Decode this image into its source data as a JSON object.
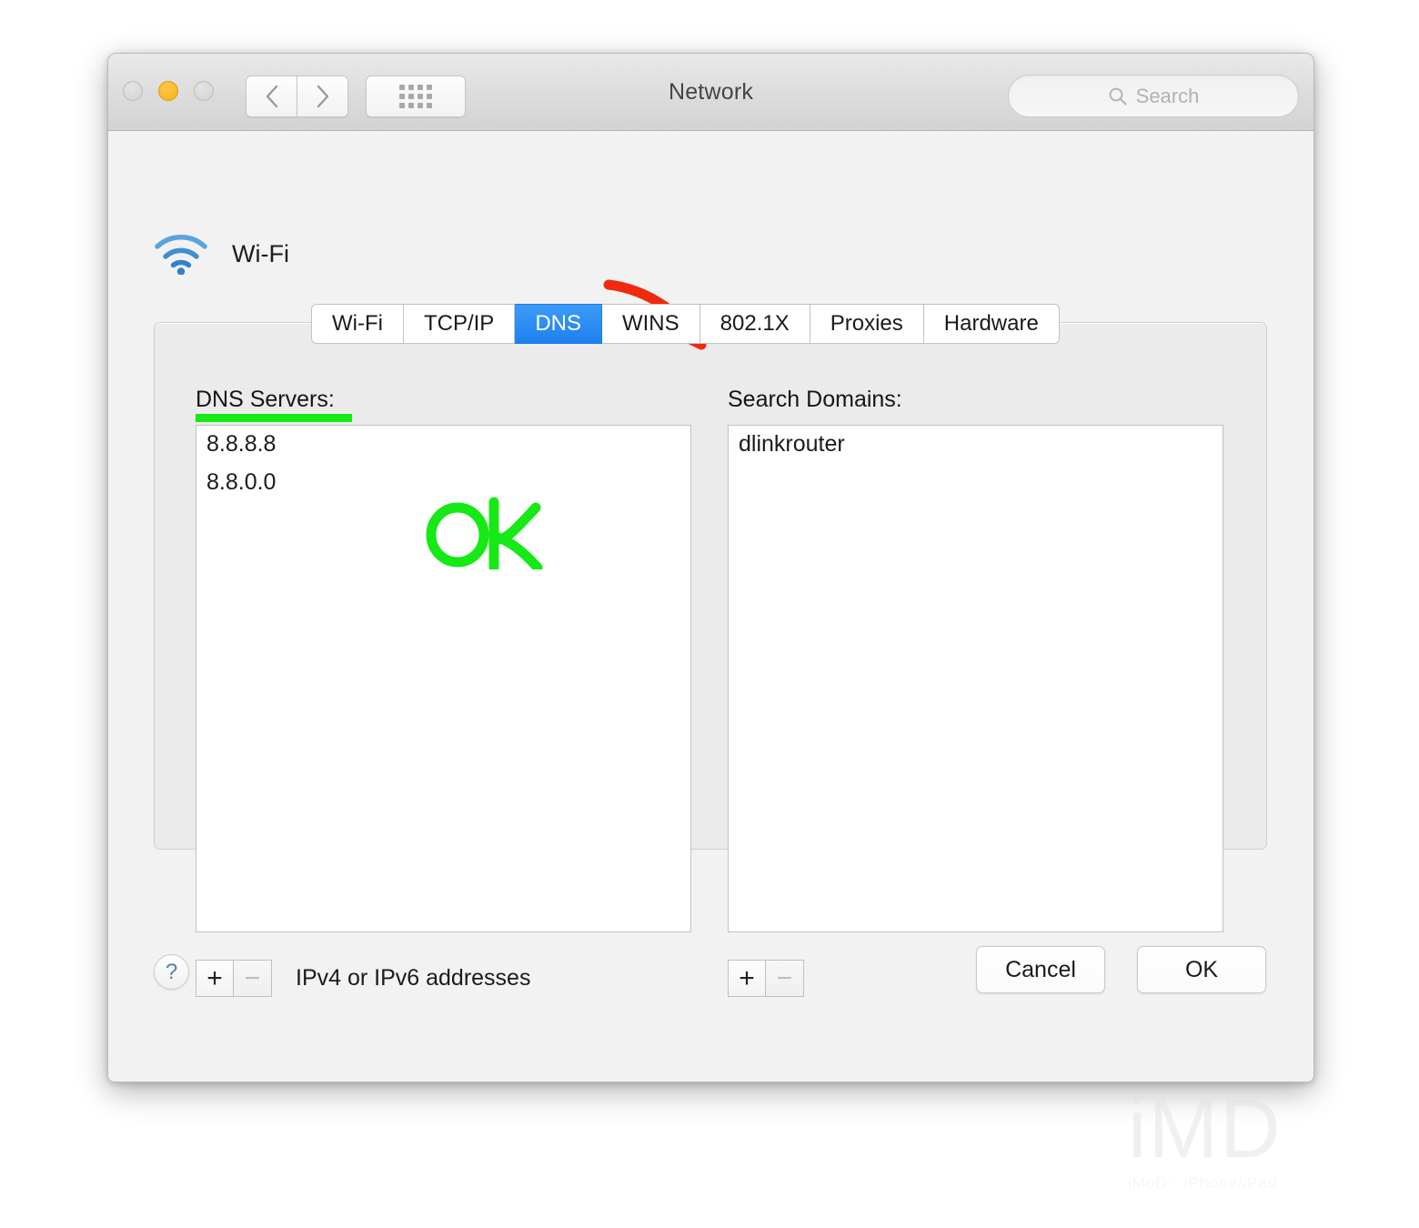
{
  "window": {
    "title": "Network",
    "traffic_lights": [
      {
        "name": "close",
        "state": "inactive",
        "color": "#d6d6d6"
      },
      {
        "name": "minimize",
        "state": "active",
        "color": "#f6b017"
      },
      {
        "name": "zoom",
        "state": "inactive",
        "color": "#d6d6d6"
      }
    ],
    "toolbar": {
      "back_icon": "chevron-left-icon",
      "forward_icon": "chevron-right-icon",
      "grid_icon": "grid-dots-icon"
    },
    "search": {
      "placeholder": "Search",
      "icon": "search-icon",
      "value": ""
    }
  },
  "service": {
    "name": "Wi-Fi",
    "icon": "wifi-icon",
    "icon_color": "#4a90d9"
  },
  "tabs": [
    {
      "label": "Wi-Fi",
      "active": false
    },
    {
      "label": "TCP/IP",
      "active": false
    },
    {
      "label": "DNS",
      "active": true
    },
    {
      "label": "WINS",
      "active": false
    },
    {
      "label": "802.1X",
      "active": false
    },
    {
      "label": "Proxies",
      "active": false
    },
    {
      "label": "Hardware",
      "active": false
    }
  ],
  "accent_color": "#1d81f0",
  "dns_servers": {
    "label": "DNS Servers:",
    "entries": [
      "8.8.8.8",
      "8.8.0.0"
    ],
    "add_label": "+",
    "remove_label": "−",
    "hint": "IPv4 or IPv6 addresses"
  },
  "search_domains": {
    "label": "Search Domains:",
    "entries": [
      "dlinkrouter"
    ],
    "add_label": "+",
    "remove_label": "−"
  },
  "footer": {
    "help_label": "?",
    "cancel_label": "Cancel",
    "ok_label": "OK"
  },
  "annotations": [
    {
      "type": "arrow",
      "color": "#f02a0e",
      "points_to": "DNS tab"
    },
    {
      "type": "underline",
      "color": "#16e916",
      "under": "DNS Servers:"
    },
    {
      "type": "handwriting",
      "text": "OK",
      "color": "#16e916"
    }
  ],
  "watermark": {
    "text": "iMD",
    "subtext": "iMoD - iPhone/iPad"
  }
}
